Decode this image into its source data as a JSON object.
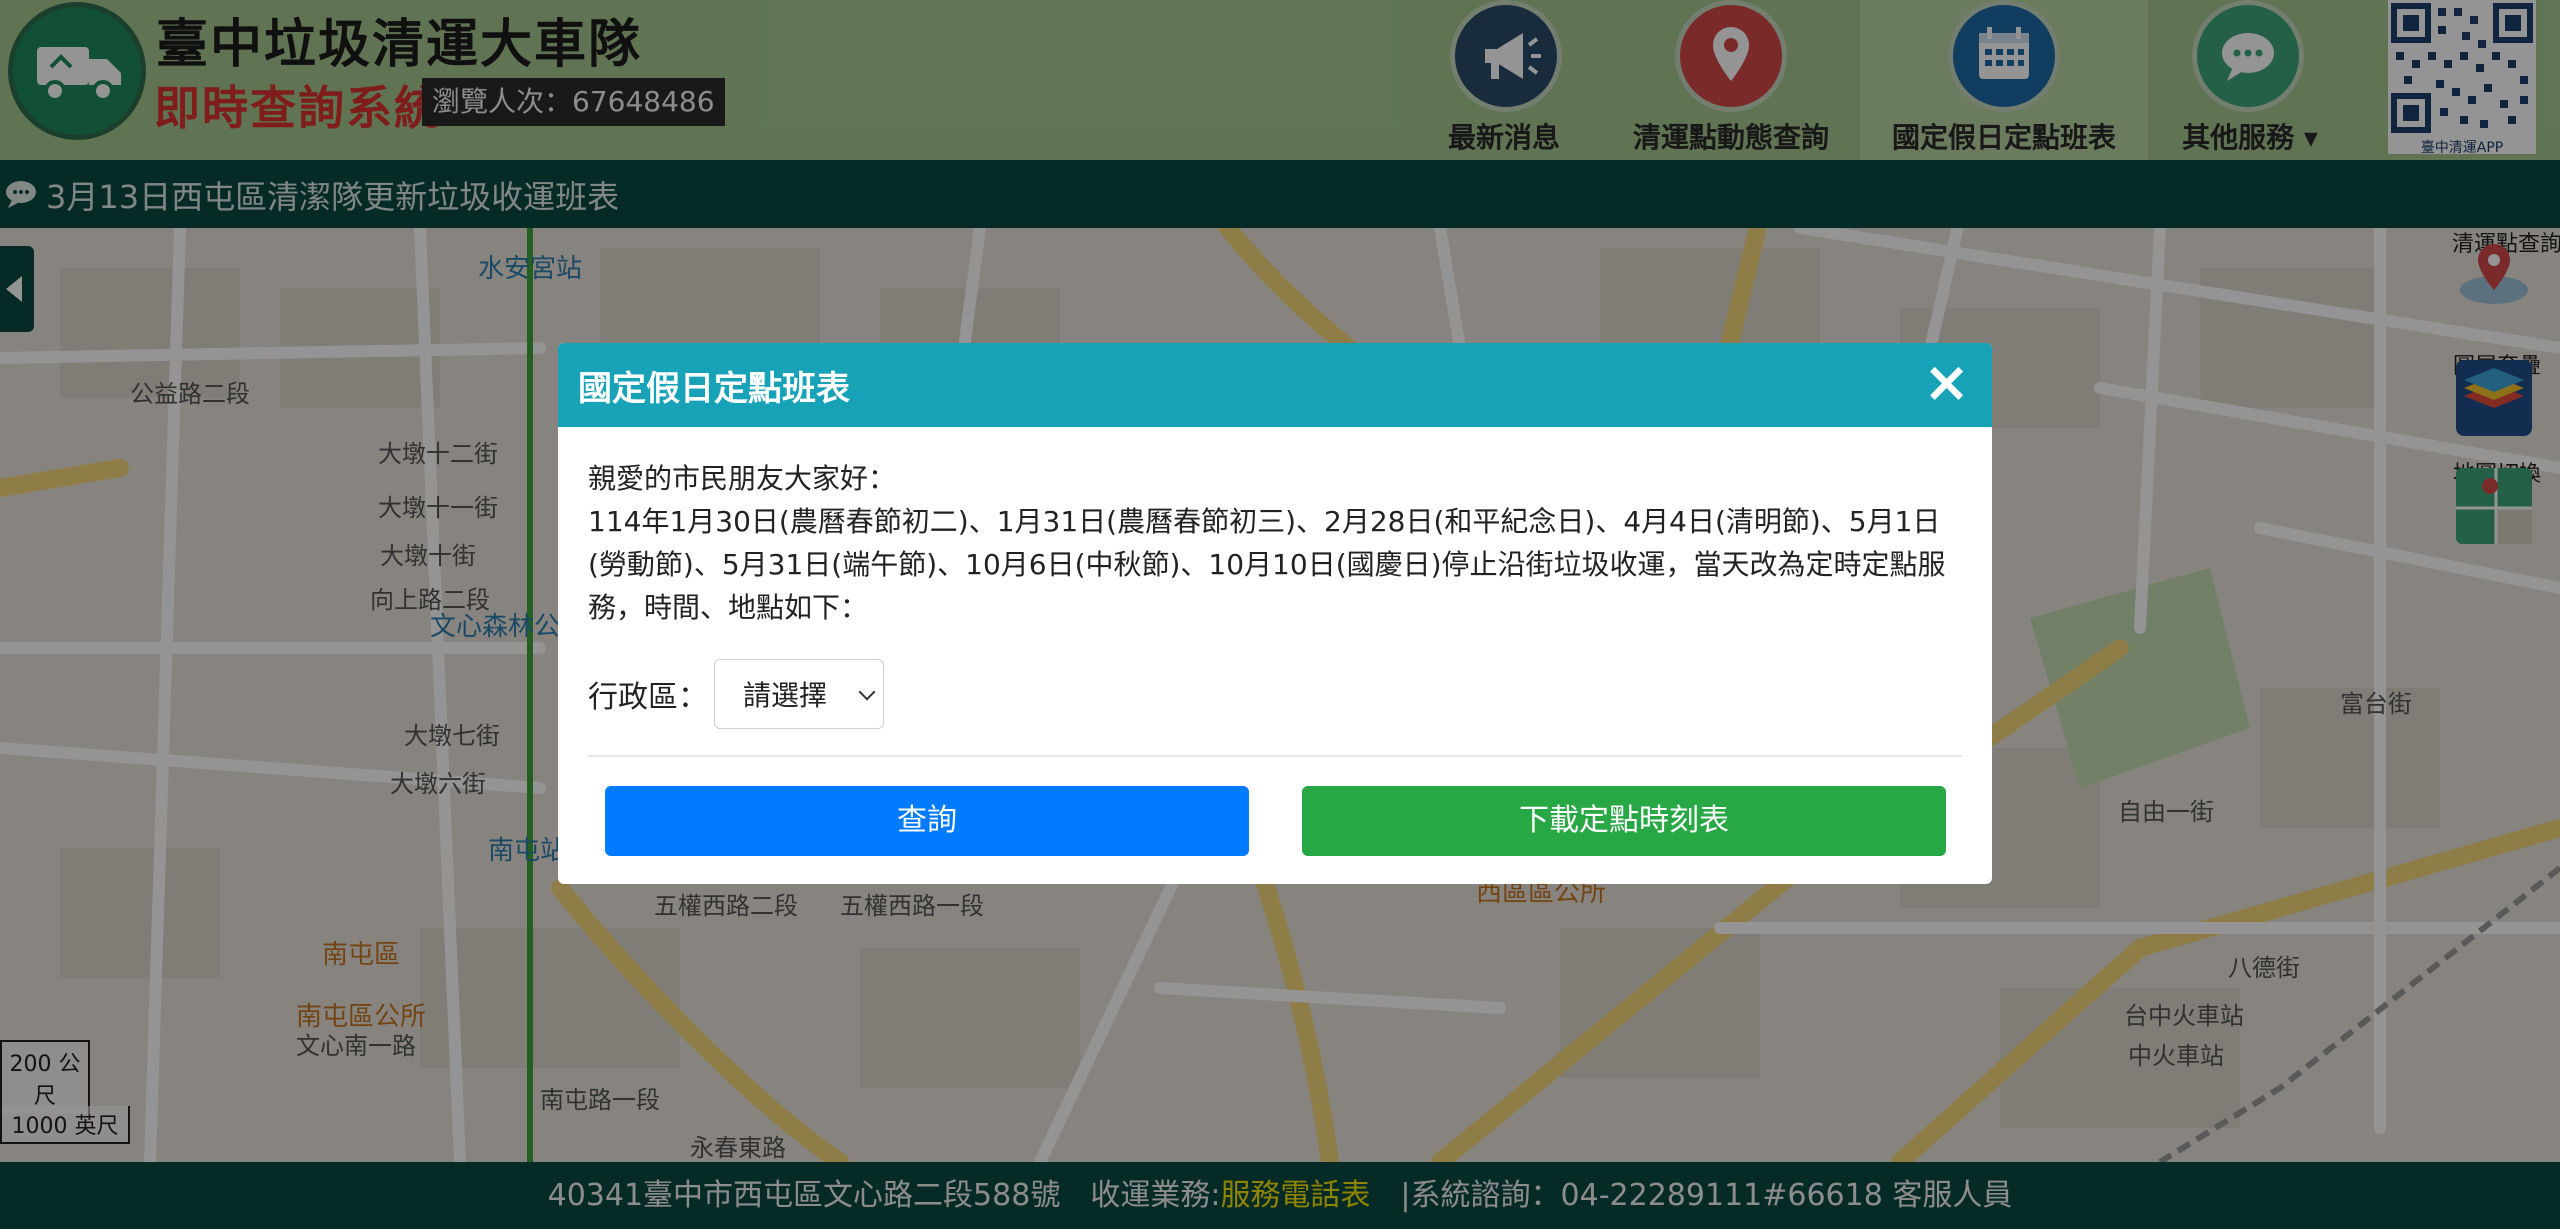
{
  "header": {
    "site_title": "臺中垃圾清運大車隊",
    "site_subtitle": "即時查詢系統",
    "visit_counter": "瀏覽人次：67648486",
    "nav": [
      {
        "label": "最新消息",
        "icon": "megaphone-icon",
        "color": "#2c4d6b"
      },
      {
        "label": "清運點動態查詢",
        "icon": "location-pin-icon",
        "color": "#d34a48"
      },
      {
        "label": "國定假日定點班表",
        "icon": "calendar-icon",
        "color": "#1e6aa8"
      },
      {
        "label": "其他服務",
        "icon": "chat-bubble-icon",
        "color": "#3fa579"
      }
    ],
    "qr_caption": "臺中清運APP"
  },
  "marquee": {
    "text": "3月13日西屯區清潔隊更新垃圾收運班表"
  },
  "map": {
    "labels": {
      "shuian": "水安宮站",
      "wenxin": "文心森林公",
      "nantun": "南屯站",
      "nantun_dist": "南屯區",
      "nantun_office": "南屯區公所",
      "xitun_office": "西區區公所",
      "taichung_station": "台中火車站",
      "taichung_station2": "中火車站",
      "wuquan2": "五權西路二段",
      "wuquan1": "五權西路一段",
      "dadun12": "大墩十二街",
      "dadun11": "大墩十一街",
      "dadun10": "大墩十街",
      "dadun7": "大墩七街",
      "dadun6": "大墩六街",
      "wenxin_nan": "文心南一路",
      "yongchun": "永春東路",
      "nantun_rd": "南屯路一段",
      "gongyi": "公益路二段",
      "xiangshang": "向上路二段",
      "ziyou": "自由一街",
      "bade": "八德街",
      "fuqian": "富台街"
    },
    "tools": [
      {
        "label": "清運點查詢",
        "icon": "map-pin-tool-icon"
      },
      {
        "label": "圖層套疊",
        "icon": "layers-icon"
      },
      {
        "label": "地圖切換",
        "icon": "map-switch-icon"
      }
    ],
    "scale_metric": "200 公尺",
    "scale_imperial": "1000 英尺"
  },
  "modal": {
    "title": "國定假日定點班表",
    "close_symbol": "×",
    "greeting": "親愛的市民朋友大家好：",
    "body": "114年1月30日(農曆春節初二)、1月31日(農曆春節初三)、2月28日(和平紀念日)、4月4日(清明節)、5月1日(勞動節)、5月31日(端午節)、10月6日(中秋節)、10月10日(國慶日)停止沿街垃圾收運，當天改為定時定點服務，時間、地點如下：",
    "district_label": "行政區：",
    "district_selected": "請選擇",
    "query_button": "查詢",
    "download_button": "下載定點時刻表"
  },
  "footer": {
    "address": "40341臺中市西屯區文心路二段588號　收運業務:",
    "phone_link": "服務電話表",
    "consult": "　|系統諮詢：04-22289111#66618 客服人員"
  },
  "colors": {
    "header_bg": "#a6c98f",
    "marquee_bg": "#0b4a44",
    "modal_header": "#17a2b8",
    "query_button": "#007bff",
    "download_button": "#28a745",
    "footer_highlight": "#f5e400"
  }
}
